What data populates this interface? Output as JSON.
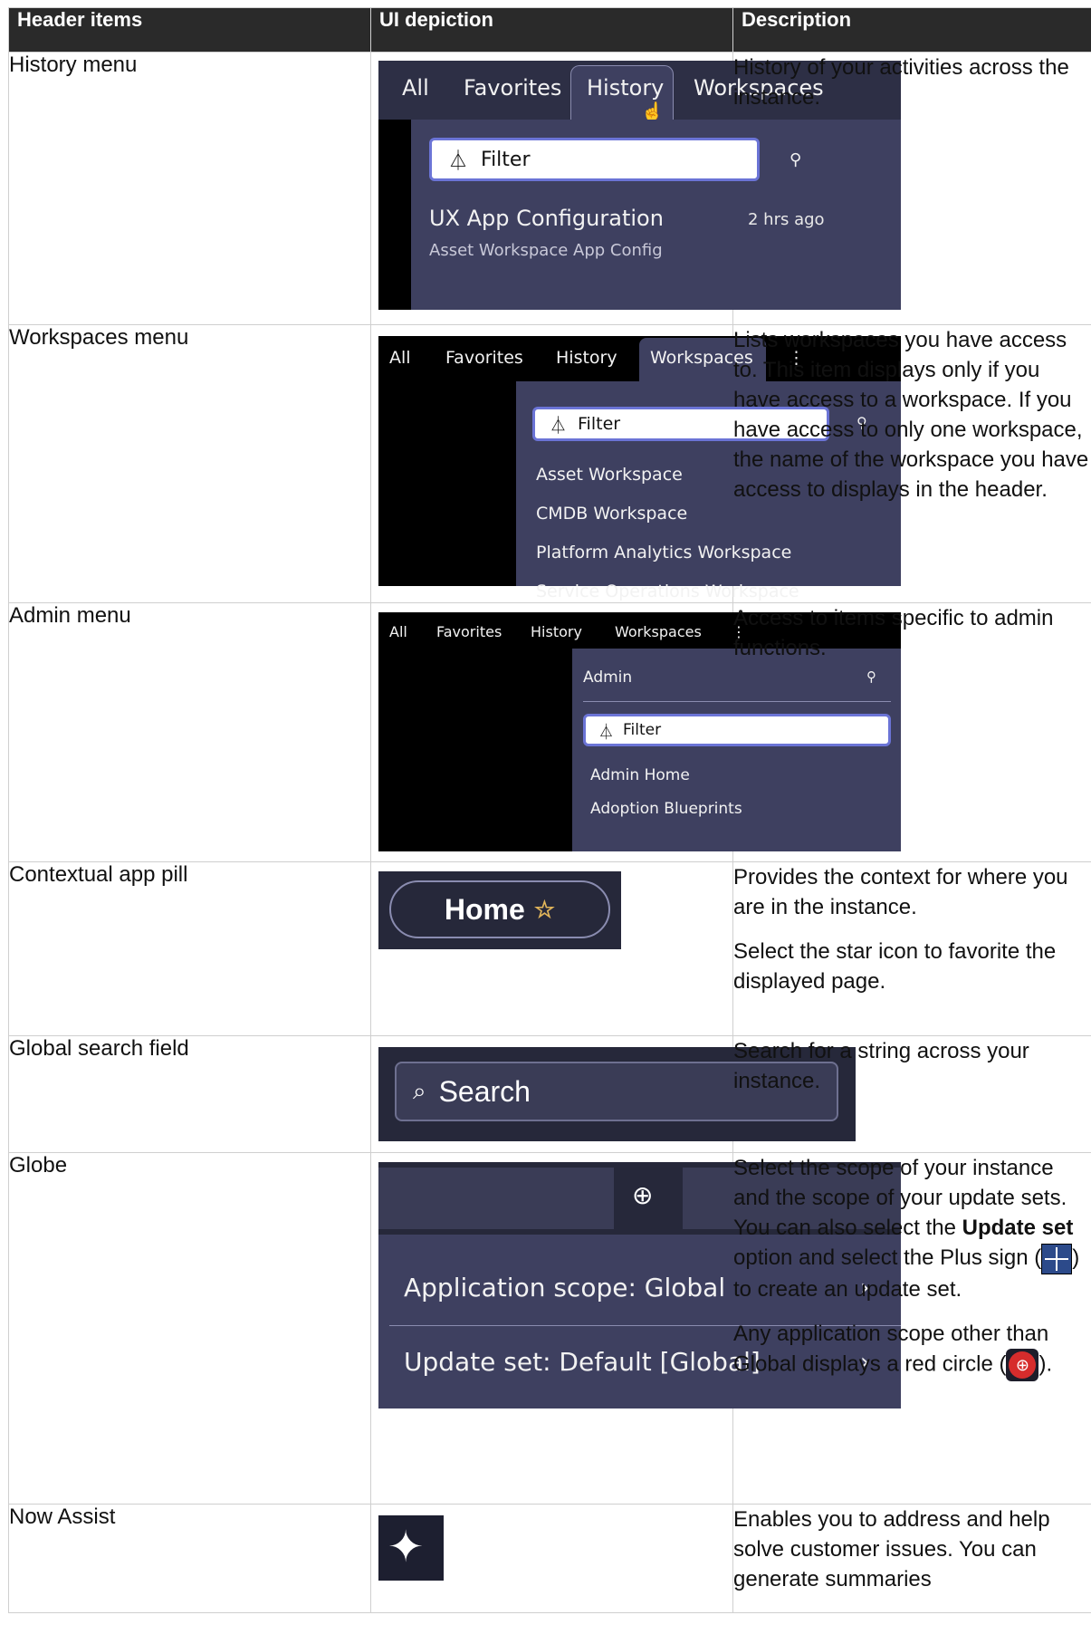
{
  "table": {
    "headers": [
      "Header items",
      "UI depiction",
      "Description"
    ]
  },
  "history": {
    "name": "History menu",
    "tabs": [
      "All",
      "Favorites",
      "History",
      "Workspaces"
    ],
    "filter": "Filter",
    "item_title": "UX App Configuration",
    "item_sub": "Asset Workspace App Config",
    "item_time": "2 hrs ago",
    "desc": "History of your activities across the instance."
  },
  "workspaces": {
    "name": "Workspaces menu",
    "tabs": [
      "All",
      "Favorites",
      "History",
      "Workspaces"
    ],
    "filter": "Filter",
    "items": [
      "Asset Workspace",
      "CMDB Workspace",
      "Platform Analytics Workspace",
      "Service Operations Workspace"
    ],
    "desc": "Lists workspaces you have access to. This item displays only if you have access to a workspace. If you have access to only one workspace, the name of the workspace you have access to displays in the header."
  },
  "admin": {
    "name": "Admin menu",
    "tabs": [
      "All",
      "Favorites",
      "History",
      "Workspaces"
    ],
    "menu_title": "Admin",
    "filter": "Filter",
    "items": [
      "Admin Home",
      "Adoption Blueprints"
    ],
    "desc": "Access to items specific to admin functions."
  },
  "app_pill": {
    "name": "Contextual app pill",
    "label": "Home",
    "desc1": "Provides the context for where you are in the instance.",
    "desc2": "Select the star icon to favorite the displayed page."
  },
  "search": {
    "name": "Global search field",
    "placeholder": "Search",
    "desc": "Search for a string across your instance."
  },
  "globe": {
    "name": "Globe",
    "scope": "Application scope: Global",
    "update_set": "Update set: Default [Global]",
    "desc_a": "Select the scope of your instance and the scope of your update sets. You can also select the ",
    "desc_bold": "Update set",
    "desc_b": " option and select the Plus sign (",
    "desc_c": ") to create an update set.",
    "desc2_a": "Any application scope other than Global displays a red circle (",
    "desc2_b": ")."
  },
  "now_assist": {
    "name": "Now Assist",
    "desc": "Enables you to address and help solve customer issues. You can generate summaries"
  }
}
